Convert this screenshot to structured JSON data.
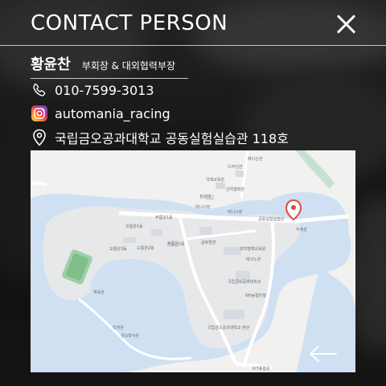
{
  "header": {
    "title": "CONTACT PERSON"
  },
  "person": {
    "name": "황윤찬",
    "role": "부회장 & 대외협력부장"
  },
  "contacts": {
    "phone": "010-7599-3013",
    "instagram": "automania_racing",
    "address": "국립금오공과대학교 공동실험실습관 118호"
  },
  "map": {
    "labels": {
      "l1": "디자인관",
      "l2": "메디슨관",
      "l3": "국제교육관",
      "l4": "산학협력관",
      "l5": "청운대",
      "l6": "테니스장",
      "l7": "공동실험실습관",
      "l8": "두레관",
      "l9": "테니스장",
      "l10": "오름관1동",
      "l11": "푸름관1동",
      "l12": "푸름관2동",
      "l13": "오름관2동",
      "l14": "오름관3동",
      "l15": "글로벌관",
      "l16": "과학영재교육원",
      "l17": "테크노관",
      "l18": "국립금오공과대학교",
      "l19": "NH농협은행",
      "l20": "체육관",
      "l21": "학생관",
      "l22": "금오학사관",
      "l23": "국립금오공과대학교 본관",
      "l24": "KIT종합문"
    },
    "colors": {
      "water": "#cfe0f3",
      "land": "#f1f1ef",
      "road": "#ffffff",
      "green": "#9fcfa8",
      "pin": "#e2473d"
    }
  }
}
